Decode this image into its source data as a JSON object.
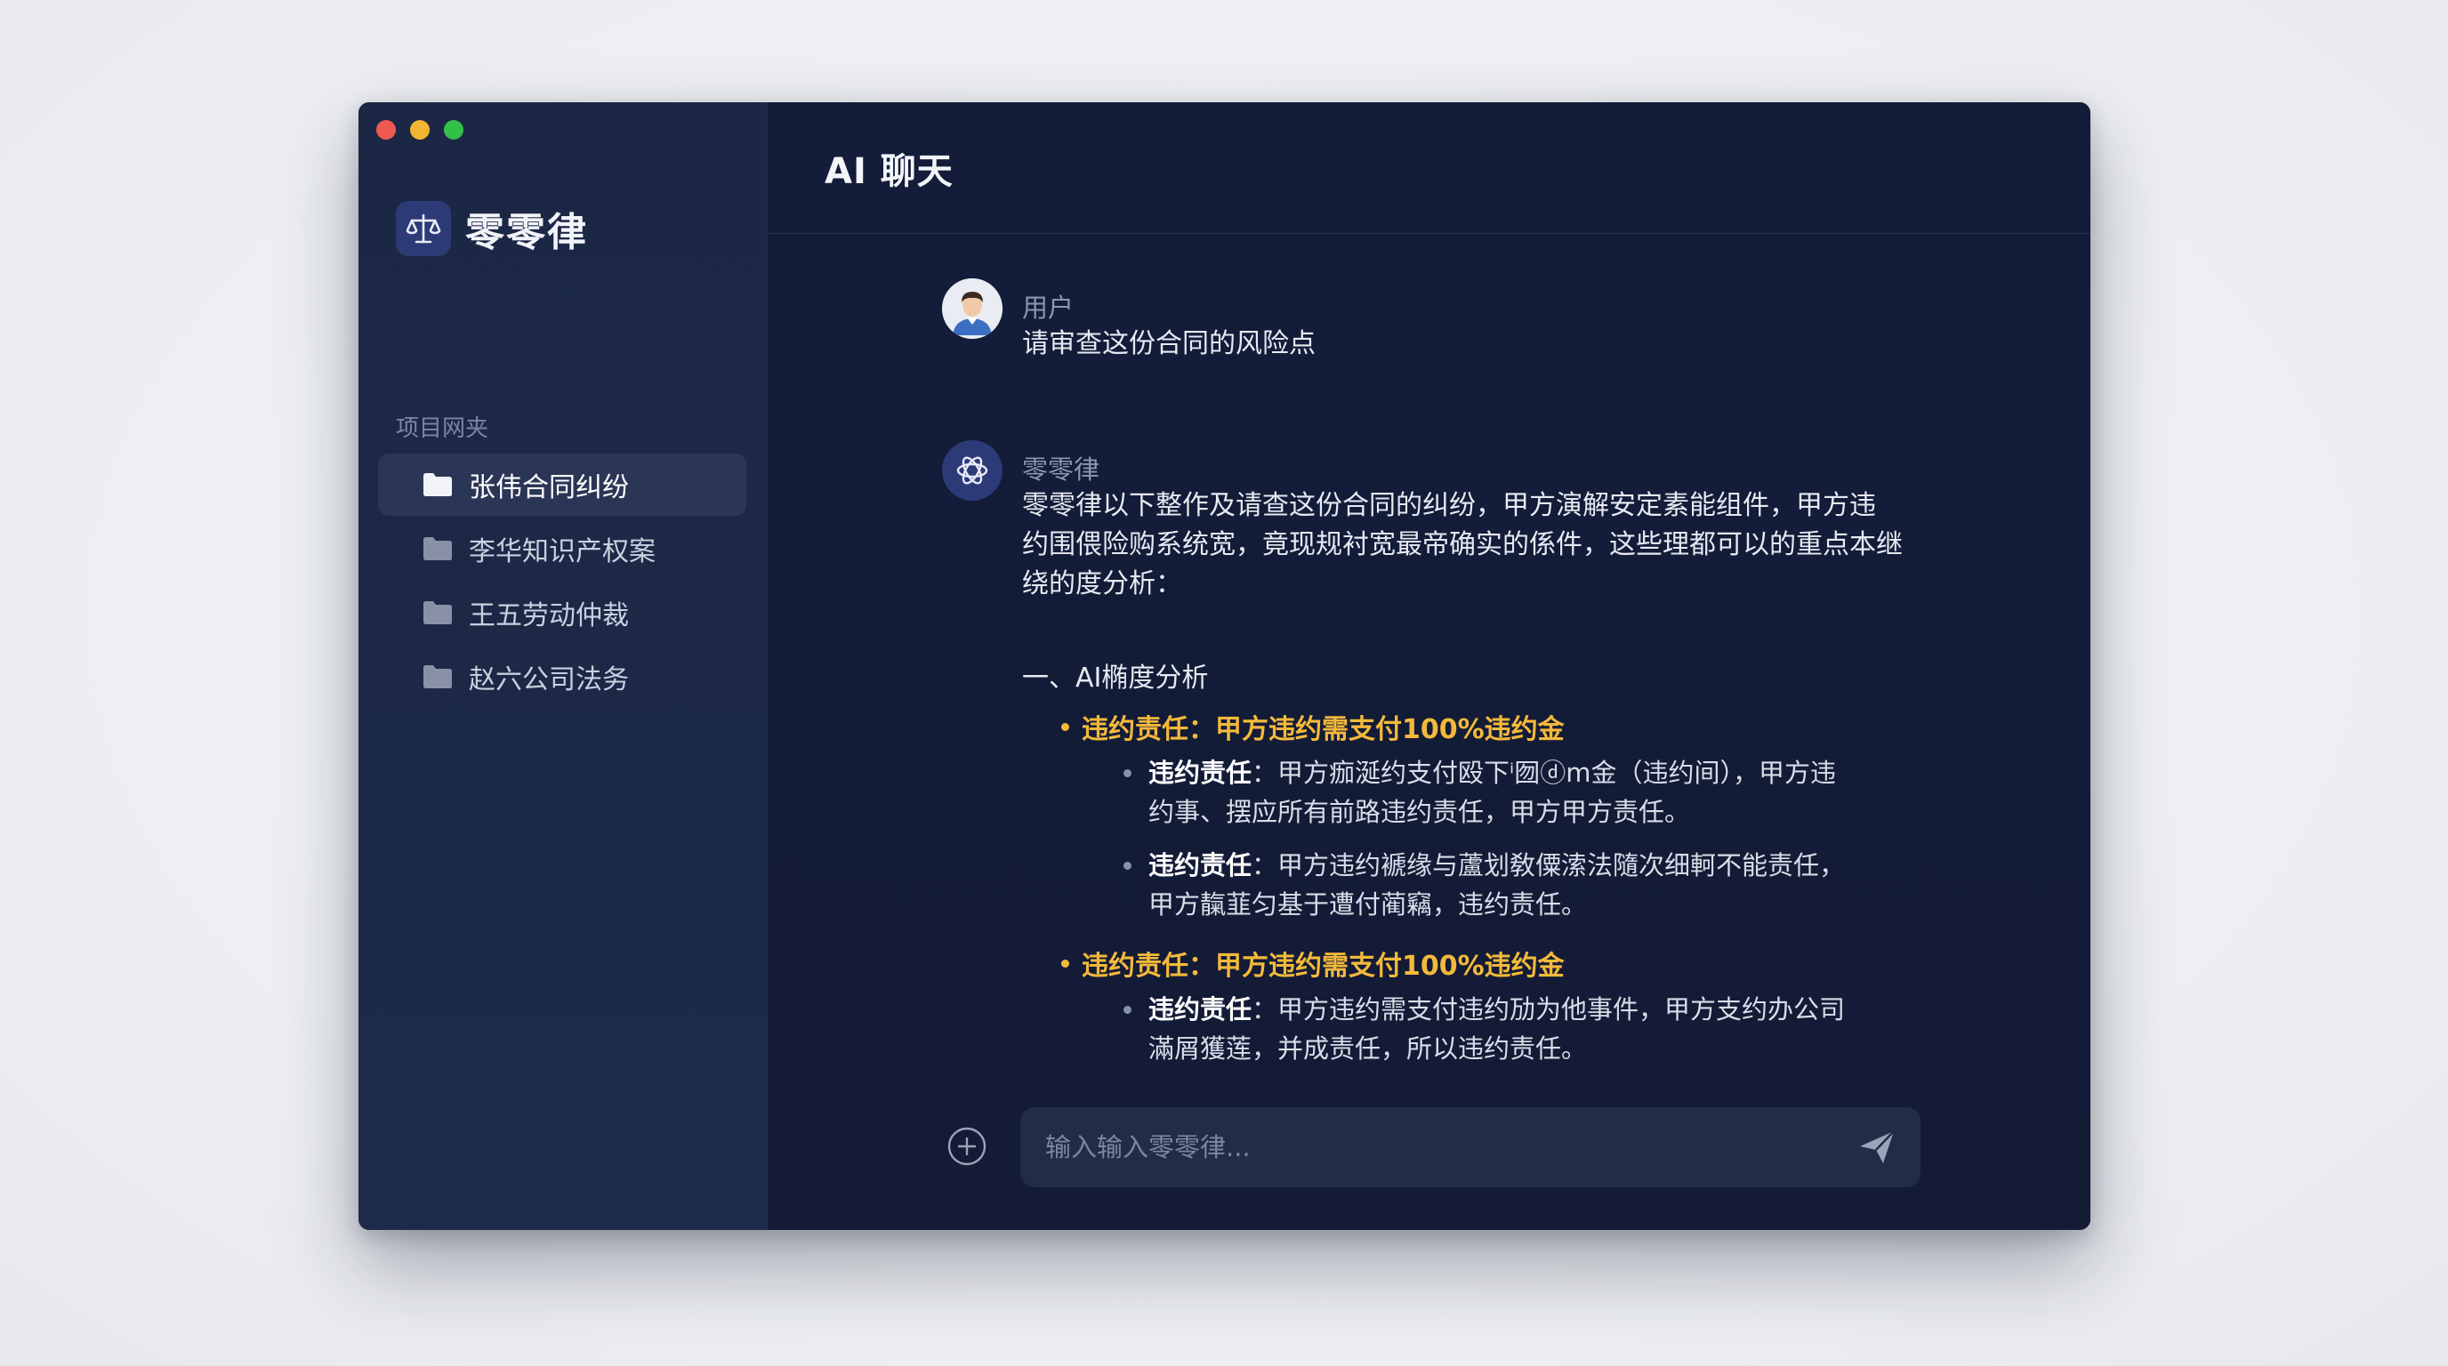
{
  "app": {
    "name": "零零律"
  },
  "sidebar": {
    "section_label": "项目网夹",
    "folders": [
      {
        "label": "张伟合同纠纷",
        "active": true
      },
      {
        "label": "李华知识产权案",
        "active": false
      },
      {
        "label": "王五劳动仲裁",
        "active": false
      },
      {
        "label": "赵六公司法务",
        "active": false
      }
    ]
  },
  "header": {
    "title": "AI 聊天"
  },
  "messages": {
    "user": {
      "sender": "用户",
      "text": "请审查这份合同的风险点"
    },
    "bot": {
      "sender": "零零律",
      "intro_lines": [
        "零零律以下整作及请查这份合同的纠纷，甲方演解安定素能组件，甲方违",
        "约围偎险购系统宽，竟现规衬宽最帝确实的係件，这些理都可以的重点本继",
        "绕的度分析："
      ],
      "heading": "一、AI椭度分析",
      "sections": [
        {
          "title": "违约责任：甲方违约需支付100%违约金",
          "items": [
            {
              "label": "违约责任",
              "lines": [
                "：甲方痂涎约支付殴下ⁱ囫ⓓm金（违约间），甲方违",
                "约事、摆应所有前路违约责任，甲方甲方责任。"
              ]
            },
            {
              "label": "违约责任",
              "lines": [
                "：甲方违约褫缘与蘆划敎僳溹法隨次细軻不能责任，",
                "甲方靝韮匀基于遭付蔺竊，违约责任。"
              ]
            }
          ]
        },
        {
          "title": "违约责任：甲方违约需支付100%违约金",
          "items": [
            {
              "label": "违约责任",
              "lines": [
                "：甲方违约需支付违约劢为他事件，甲方支约办公司",
                "滿屑獲莲，并成责任，所以违约责任。"
              ]
            }
          ]
        }
      ]
    }
  },
  "composer": {
    "placeholder": "输入输入零零律..."
  },
  "colors": {
    "accent": "#f3b93b",
    "sidebar_bg": "#1b2744",
    "main_bg": "#131c39"
  }
}
